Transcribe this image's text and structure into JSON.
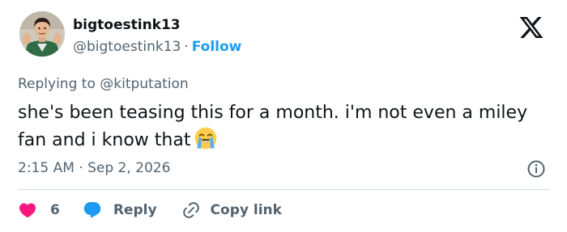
{
  "author": {
    "display_name": "bigtoestink13",
    "handle": "@bigtoestink13",
    "separator": "·",
    "follow_label": "Follow"
  },
  "reply_context": {
    "prefix": "Replying to",
    "mention": "@kitputation"
  },
  "tweet": {
    "text": "she's been teasing this for a month. i'm not even a miley fan and i know that",
    "emoji": "loudly-crying-face"
  },
  "meta": {
    "time": "2:15 AM",
    "separator": "·",
    "date": "Sep 2, 2026"
  },
  "actions": {
    "like_count": "6",
    "reply_label": "Reply",
    "copy_link_label": "Copy link"
  },
  "colors": {
    "accent": "#1d9bf0",
    "like": "#f91880",
    "text": "#0f1419",
    "secondary": "#536471",
    "divider": "#cfd9de"
  },
  "icons": [
    "x-logo-icon",
    "info-icon",
    "heart-icon",
    "reply-bubble-icon",
    "link-icon",
    "avatar-photo"
  ]
}
